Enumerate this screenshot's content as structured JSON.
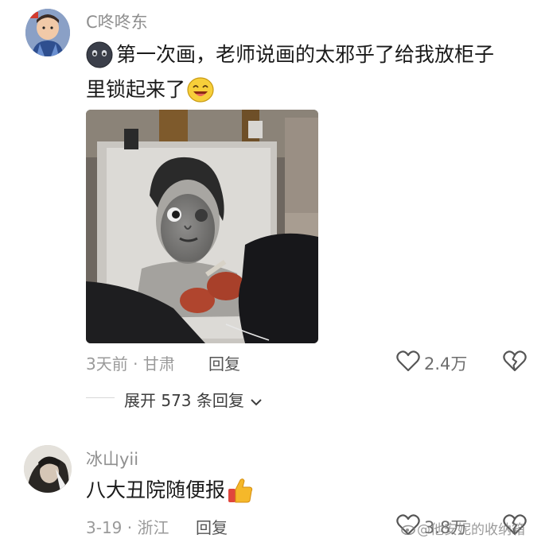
{
  "comments": [
    {
      "username": "C咚咚东",
      "text_line1": "第一次画，老师说画的太邪乎了给我放柜子",
      "text_line2": "里锁起来了",
      "time_location": "3天前 · 甘肃",
      "reply_label": "回复",
      "like_count": "2.4万"
    },
    {
      "username": "冰山yii",
      "text": "八大丑院随便报",
      "time_location": "3-19 · 浙江",
      "reply_label": "回复",
      "like_count": "3.8万"
    }
  ],
  "expand_replies": "展开 573 条回复",
  "watermark": "@他安妮的收纳箱",
  "icons": {
    "like": "heart-outline-icon",
    "dislike": "broken-heart-icon",
    "expand": "chevron-down-icon",
    "emoji_dark": "dark-face-emoji",
    "emoji_smile": "smiling-face-emoji",
    "emoji_thumb": "thumbs-up-emoji"
  },
  "colors": {
    "username": "#8f8f8f",
    "text": "#1a1a1a",
    "meta": "#9a9a9a"
  }
}
